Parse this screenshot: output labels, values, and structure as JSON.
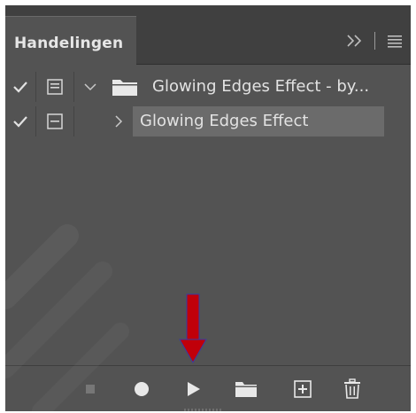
{
  "panel": {
    "tab_label": "Handelingen",
    "header_icons": [
      "collapse-panels-icon",
      "panel-menu-icon"
    ]
  },
  "actions": [
    {
      "kind": "set",
      "checked": true,
      "dialog_toggle": true,
      "expanded": true,
      "icon": "folder-icon",
      "label": "Glowing Edges Effect - by...",
      "selected": false
    },
    {
      "kind": "action",
      "checked": true,
      "dialog_toggle": true,
      "expanded": false,
      "label": "Glowing Edges  Effect",
      "selected": true
    }
  ],
  "toolbar": {
    "buttons": [
      "stop-icon",
      "record-icon",
      "play-icon",
      "new-set-icon",
      "new-action-icon",
      "delete-icon"
    ]
  },
  "annotation": {
    "arrow_color": "#c0000a",
    "points_to": "play-button"
  },
  "colors": {
    "panel_bg": "#535353",
    "header_bg": "#404040",
    "selected_row_bg": "#6b6b6b",
    "text": "#e2e2e2"
  }
}
